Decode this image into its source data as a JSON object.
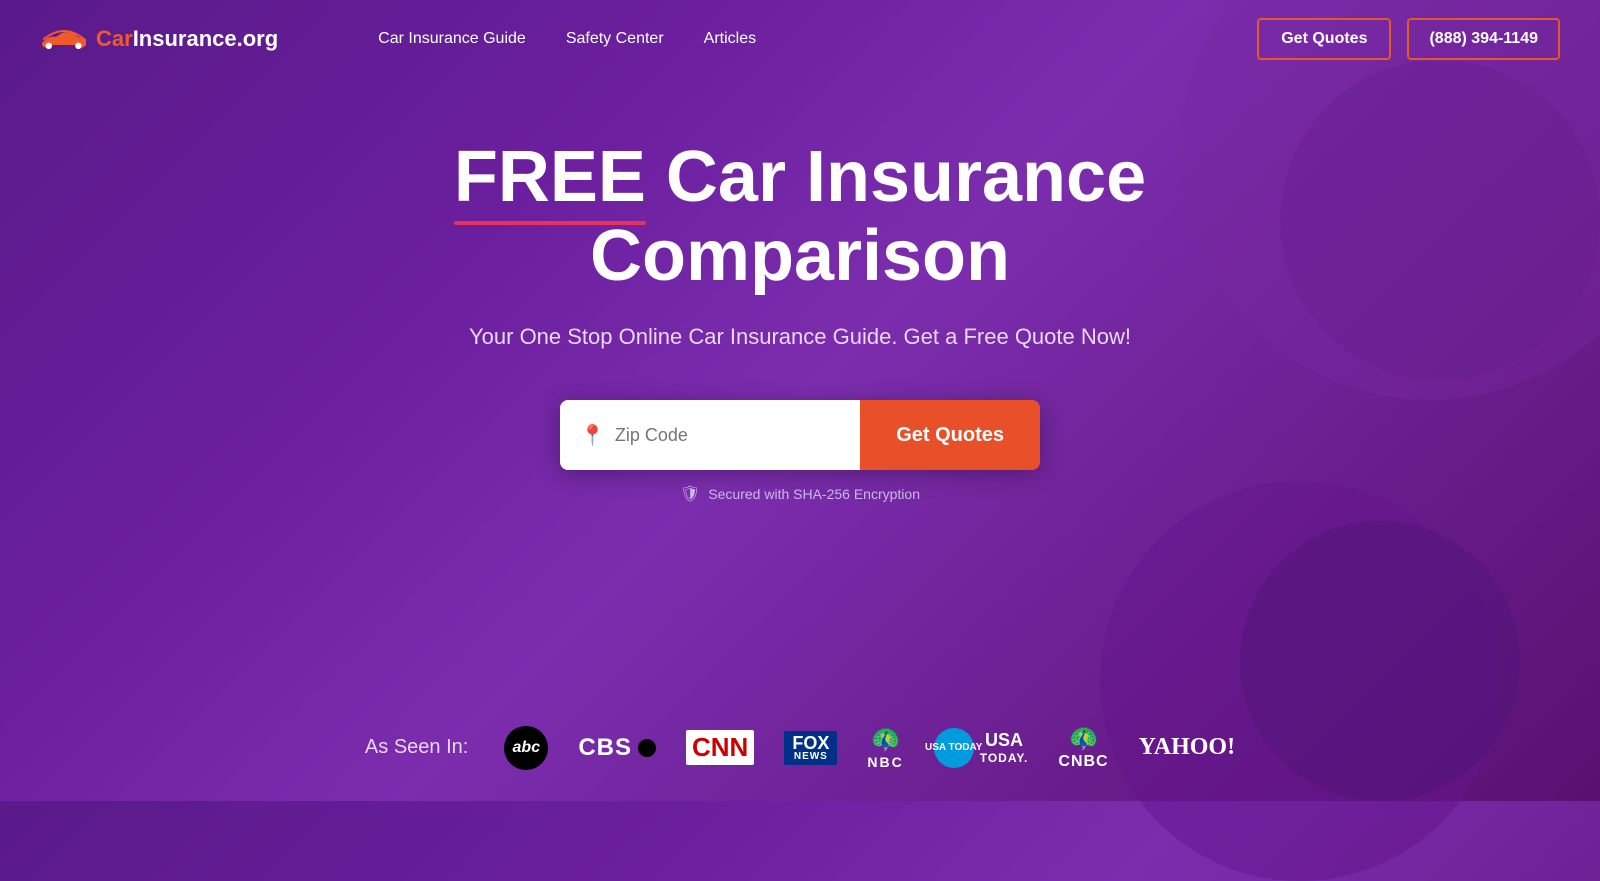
{
  "logo": {
    "car_part": "Car",
    "rest_part": "Insurance.org"
  },
  "nav": {
    "items": [
      {
        "label": "Car Insurance Guide"
      },
      {
        "label": "Safety Center"
      },
      {
        "label": "Articles"
      }
    ]
  },
  "header": {
    "get_quotes_label": "Get Quotes",
    "phone_label": "(888) 394-1149"
  },
  "hero": {
    "title_free": "FREE",
    "title_rest": " Car Insurance Comparison",
    "subtitle": "Your One Stop Online Car Insurance Guide. Get a Free Quote Now!"
  },
  "zip_form": {
    "placeholder": "Zip Code",
    "get_quotes_label": "Get Quotes"
  },
  "security": {
    "text": "Secured with SHA-256 Encryption"
  },
  "as_seen_in": {
    "label": "As Seen In:",
    "logos": [
      {
        "name": "abc",
        "display": "abc"
      },
      {
        "name": "cbs",
        "display": "CBS"
      },
      {
        "name": "cnn",
        "display": "CNN"
      },
      {
        "name": "fox-news",
        "display": "FOX NEWS"
      },
      {
        "name": "nbc",
        "display": "NBC"
      },
      {
        "name": "usa-today",
        "display": "USA TODAY."
      },
      {
        "name": "cnbc",
        "display": "CNBC"
      },
      {
        "name": "yahoo",
        "display": "YAHOO!"
      }
    ]
  }
}
